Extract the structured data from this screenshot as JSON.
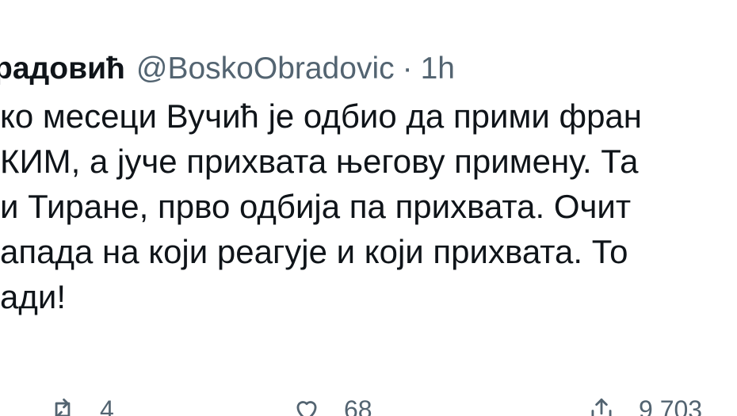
{
  "tweet": {
    "author_name": "радовић",
    "handle": "@BoskoObradovic",
    "separator": "·",
    "time": "1h",
    "lines": [
      "ко месеци Вучић је одбио да прими фран",
      "КИМ, а јуче прихвата његову примену. Та",
      "и Тиране, прво одбија па прихвата. Очит",
      "апада на који реагује и који прихвата. То",
      "ади!"
    ],
    "retweet_count": "4",
    "like_count": "68",
    "share_count": "9 703"
  },
  "icons": {
    "retweet": "retweet-icon",
    "like": "heart-icon",
    "share": "share-icon"
  },
  "colors": {
    "text": "#0f1419",
    "muted": "#536471"
  }
}
